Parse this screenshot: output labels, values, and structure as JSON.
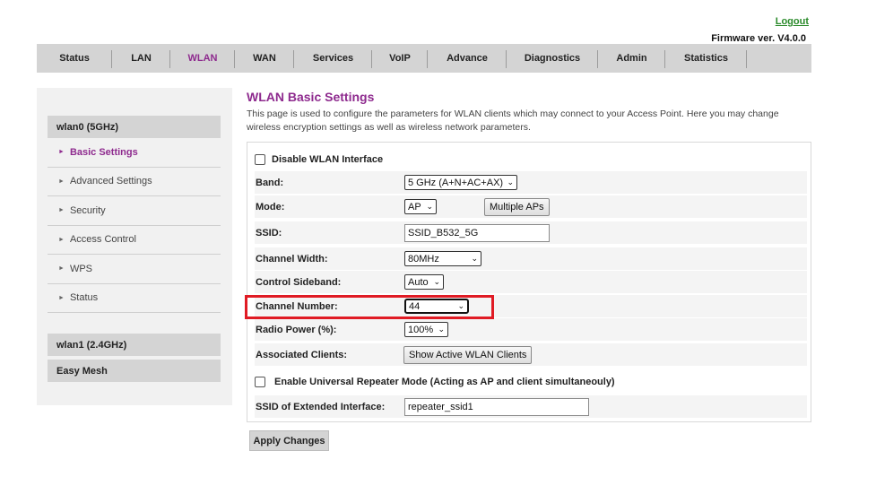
{
  "header": {
    "logout_label": "Logout",
    "firmware_label": "Firmware ver. V4.0.0"
  },
  "nav": {
    "items": [
      {
        "label": "Status"
      },
      {
        "label": "LAN"
      },
      {
        "label": "WLAN"
      },
      {
        "label": "WAN"
      },
      {
        "label": "Services"
      },
      {
        "label": "VoIP"
      },
      {
        "label": "Advance"
      },
      {
        "label": "Diagnostics"
      },
      {
        "label": "Admin"
      },
      {
        "label": "Statistics"
      }
    ],
    "active": "WLAN"
  },
  "sidebar": {
    "group_5g": "wlan0 (5GHz)",
    "items": [
      {
        "label": "Basic Settings"
      },
      {
        "label": "Advanced Settings"
      },
      {
        "label": "Security"
      },
      {
        "label": "Access Control"
      },
      {
        "label": "WPS"
      },
      {
        "label": "Status"
      }
    ],
    "active": "Basic Settings",
    "group_24g": "wlan1 (2.4GHz)",
    "group_mesh": "Easy Mesh"
  },
  "page": {
    "title": "WLAN Basic Settings",
    "description": "This page is used to configure the parameters for WLAN clients which may connect to your Access Point. Here you may change wireless encryption settings as well as wireless network parameters."
  },
  "form": {
    "disable_wlan_label": "Disable WLAN Interface",
    "band_label": "Band:",
    "band_value": "5 GHz (A+N+AC+AX)",
    "mode_label": "Mode:",
    "mode_value": "AP",
    "multiple_aps_label": "Multiple APs",
    "ssid_label": "SSID:",
    "ssid_value": "SSID_B532_5G",
    "channel_width_label": "Channel Width:",
    "channel_width_value": "80MHz",
    "control_sideband_label": "Control Sideband:",
    "control_sideband_value": "Auto",
    "channel_number_label": "Channel Number:",
    "channel_number_value": "44",
    "radio_power_label": "Radio Power (%):",
    "radio_power_value": "100%",
    "associated_clients_label": "Associated Clients:",
    "show_clients_label": "Show Active WLAN Clients",
    "repeater_label": "Enable Universal Repeater Mode (Acting as AP and client simultaneouly)",
    "ext_ssid_label": "SSID of Extended Interface:",
    "ext_ssid_value": "repeater_ssid1",
    "apply_label": "Apply Changes"
  },
  "colors": {
    "accent": "#8e2a8e",
    "logout": "#2a8a2a",
    "highlight": "#e01b24",
    "nav_bg": "#d4d4d4"
  }
}
